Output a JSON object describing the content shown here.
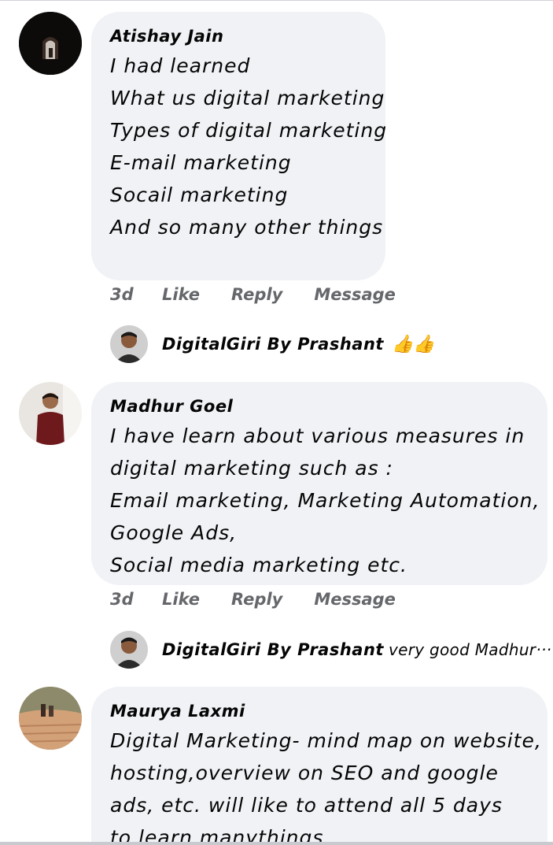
{
  "comments": [
    {
      "author": "Atishay Jain",
      "lines": [
        "I had learned",
        "What us digital marketing",
        "Types of digital marketing",
        "E-mail marketing",
        "Socail marketing",
        "And so many other things"
      ],
      "time": "3d",
      "like": "Like",
      "reply": "Reply",
      "message": "Message",
      "reply_author": "DigitalGiri By Prashant",
      "reply_text": "",
      "reply_emoji": "👍👍"
    },
    {
      "author": "Madhur Goel",
      "lines": [
        "I have learn about various measures in",
        "digital marketing such as :",
        "Email marketing, Marketing Automation,",
        "Google Ads,",
        "Social media marketing etc."
      ],
      "time": "3d",
      "like": "Like",
      "reply": "Reply",
      "message": "Message",
      "reply_author": "DigitalGiri By Prashant",
      "reply_text": "very good Madhur···"
    },
    {
      "author": "Maurya Laxmi",
      "lines": [
        "Digital Marketing- mind map on website,",
        "hosting,overview on SEO and google",
        "ads, etc. will like to attend all 5 days",
        "to learn manythings"
      ]
    }
  ],
  "colors": {
    "bubble": "#f0f2f5",
    "muted": "#65676b",
    "text": "#050505"
  }
}
